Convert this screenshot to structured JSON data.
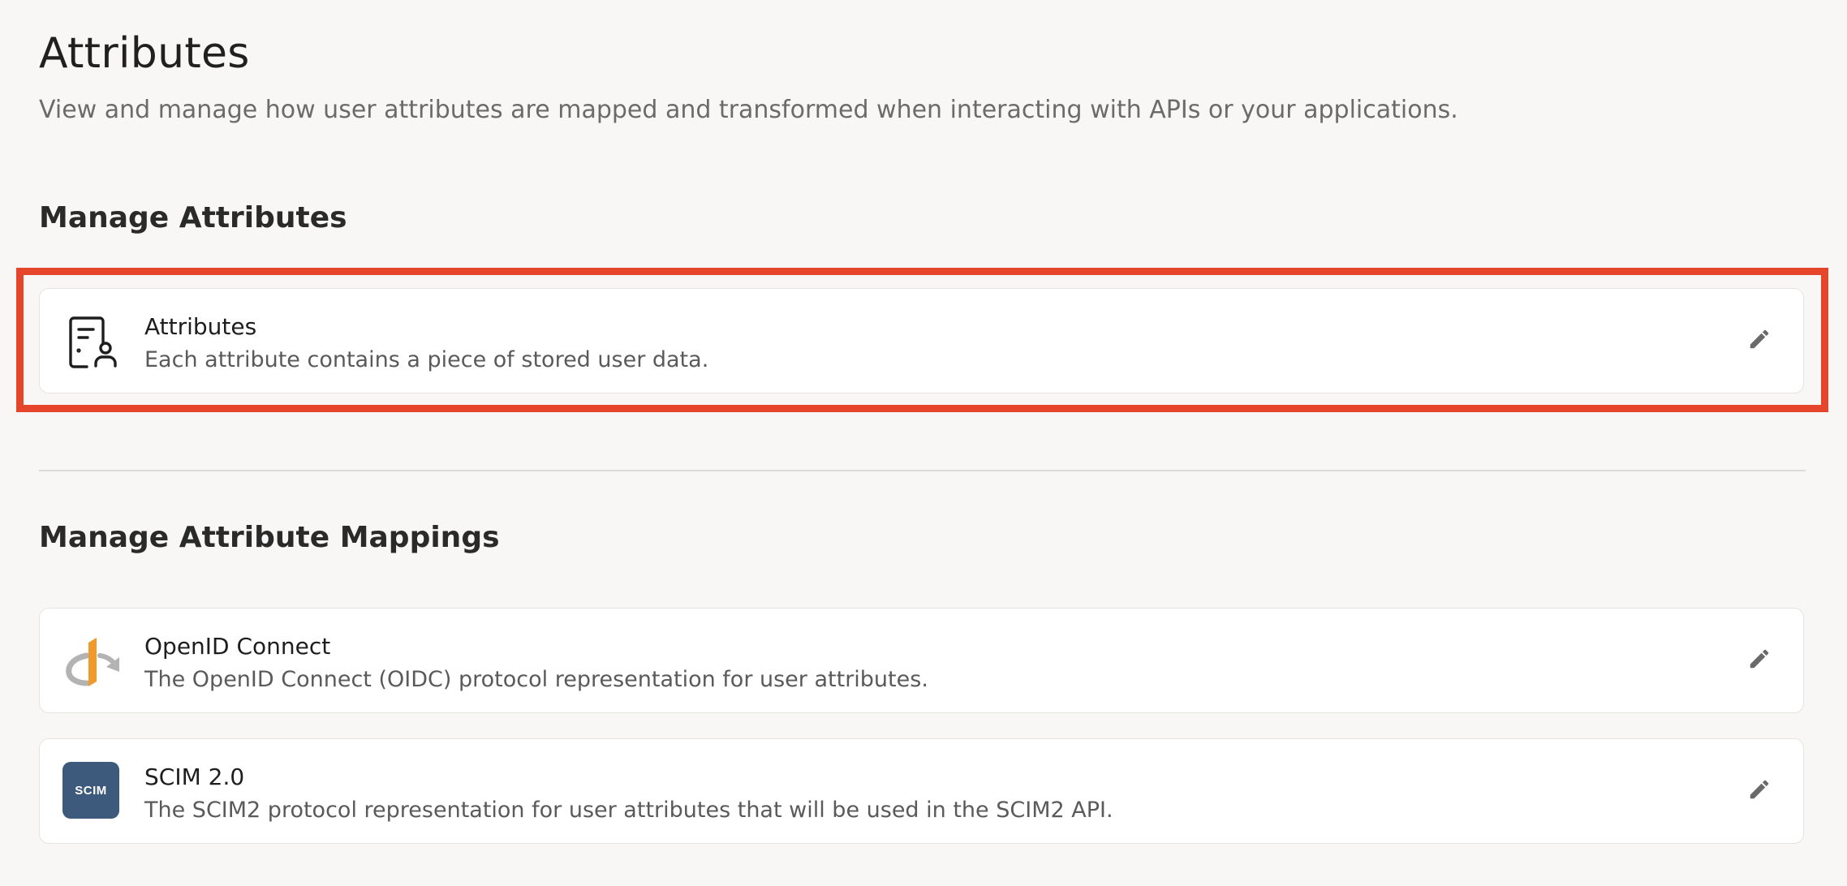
{
  "header": {
    "title": "Attributes",
    "description": "View and manage how user attributes are mapped and transformed when interacting with APIs or your applications."
  },
  "sections": {
    "manage_attributes": {
      "title": "Manage Attributes",
      "cards": [
        {
          "icon": "user-attributes-icon",
          "title": "Attributes",
          "description": "Each attribute contains a piece of stored user data.",
          "action_icon": "pencil-icon"
        }
      ]
    },
    "manage_mappings": {
      "title": "Manage Attribute Mappings",
      "cards": [
        {
          "icon": "openid-logo",
          "title": "OpenID Connect",
          "description": "The OpenID Connect (OIDC) protocol representation for user attributes.",
          "action_icon": "pencil-icon"
        },
        {
          "icon": "scim-logo",
          "icon_text": "SCIM",
          "title": "SCIM 2.0",
          "description": "The SCIM2 protocol representation for user attributes that will be used in the SCIM2 API.",
          "action_icon": "pencil-icon"
        }
      ]
    }
  },
  "colors": {
    "background": "#f8f7f5",
    "card_background": "#ffffff",
    "highlight": "#e5452b",
    "scim_badge": "#3d5a7c",
    "openid_orange": "#f09a2c",
    "openid_gray": "#b3b3b3"
  }
}
